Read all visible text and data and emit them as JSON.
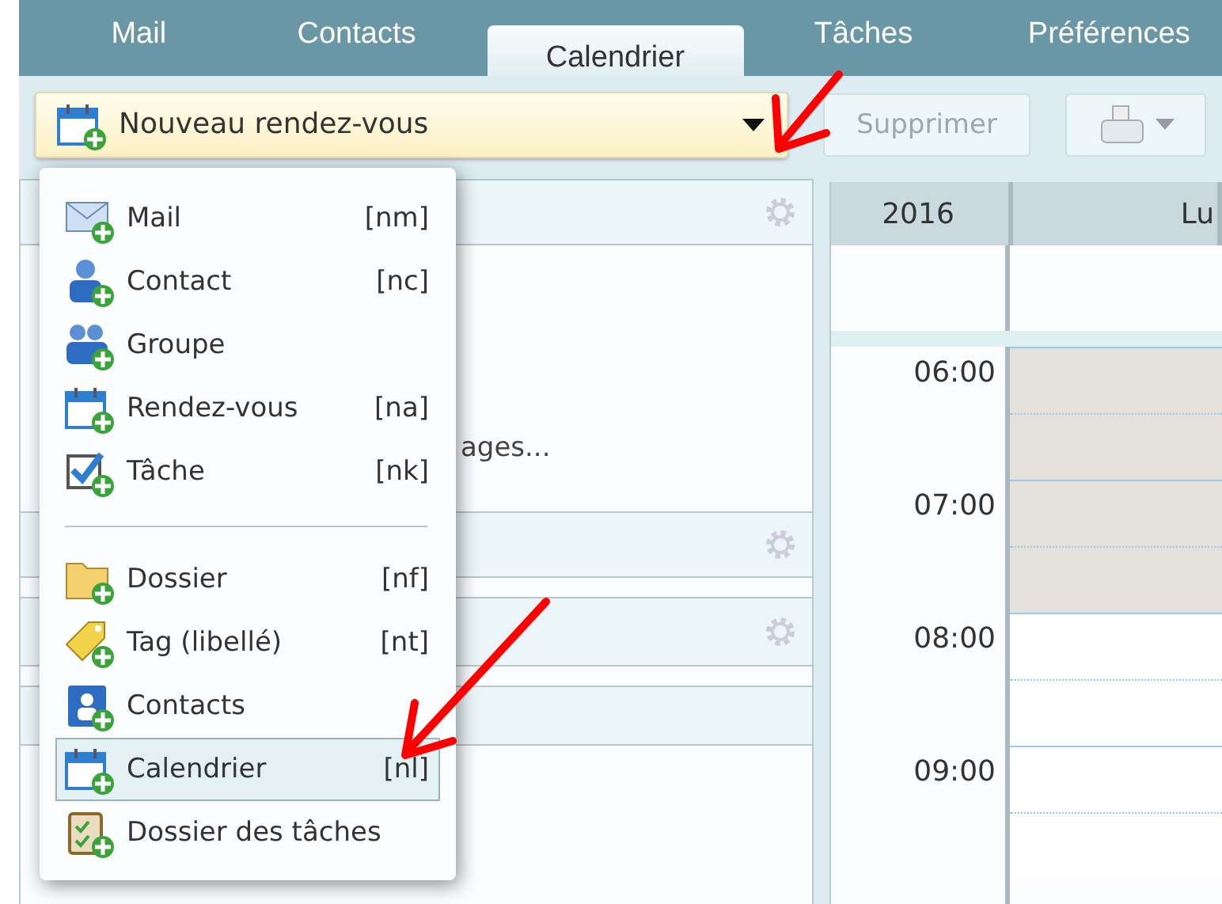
{
  "tabs": [
    {
      "label": "Mail",
      "selected": false
    },
    {
      "label": "Contacts",
      "selected": false
    },
    {
      "label": "Calendrier",
      "selected": true
    },
    {
      "label": "Tâches",
      "selected": false
    },
    {
      "label": "Préférences",
      "selected": false
    }
  ],
  "toolbar": {
    "new_button": {
      "label": "Nouveau rendez-vous"
    },
    "delete_button": {
      "label": "Supprimer",
      "disabled": true
    }
  },
  "left_panel": {
    "partial_text": "ages..."
  },
  "calendar": {
    "year": "2016",
    "day_header": "Lu",
    "hours": [
      "06:00",
      "07:00",
      "08:00",
      "09:00"
    ]
  },
  "new_menu": {
    "groups": [
      [
        {
          "label": "Mail",
          "shortcut": "[nm]",
          "selected": false
        },
        {
          "label": "Contact",
          "shortcut": "[nc]",
          "selected": false
        },
        {
          "label": "Groupe",
          "selected": false
        },
        {
          "label": "Rendez-vous",
          "shortcut": "[na]",
          "selected": false
        },
        {
          "label": "Tâche",
          "shortcut": "[nk]",
          "selected": false
        }
      ],
      [
        {
          "label": "Dossier",
          "shortcut": "[nf]",
          "selected": false
        },
        {
          "label": "Tag (libellé)",
          "shortcut": "[nt]",
          "selected": false
        },
        {
          "label": "Contacts",
          "selected": false
        },
        {
          "label": "Calendrier",
          "shortcut": "[nl]",
          "selected": true
        },
        {
          "label": "Dossier des tâches",
          "selected": false
        }
      ]
    ]
  }
}
